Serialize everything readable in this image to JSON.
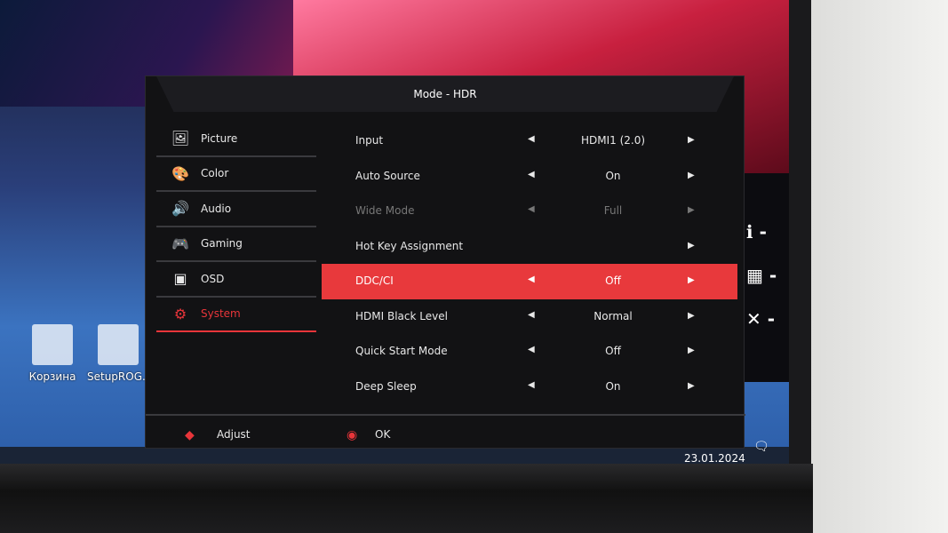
{
  "osd": {
    "title": "Mode - HDR",
    "menu": [
      {
        "label": "Picture",
        "icon": "picture-icon",
        "glyph": "🖼"
      },
      {
        "label": "Color",
        "icon": "palette-icon",
        "glyph": "🎨"
      },
      {
        "label": "Audio",
        "icon": "speaker-icon",
        "glyph": "🔊"
      },
      {
        "label": "Gaming",
        "icon": "gamepad-icon",
        "glyph": "🎮"
      },
      {
        "label": "OSD",
        "icon": "osd-window-icon",
        "glyph": "▣"
      },
      {
        "label": "System",
        "icon": "gear-icon",
        "glyph": "⚙",
        "active": true
      }
    ],
    "settings": [
      {
        "label": "Input",
        "value": "HDMI1 (2.0)"
      },
      {
        "label": "Auto Source",
        "value": "On"
      },
      {
        "label": "Wide Mode",
        "value": "Full",
        "disabled": true
      },
      {
        "label": "Hot Key Assignment",
        "value": ""
      },
      {
        "label": "DDC/CI",
        "value": "Off",
        "selected": true
      },
      {
        "label": "HDMI Black Level",
        "value": "Normal"
      },
      {
        "label": "Quick Start Mode",
        "value": "Off"
      },
      {
        "label": "Deep Sleep",
        "value": "On"
      }
    ],
    "footer": {
      "adjust": "Adjust",
      "ok": "OK"
    },
    "accent": "#e8393c"
  },
  "desktop": {
    "icons": [
      "Корзина",
      "SetupROG..."
    ],
    "date": "23.01.2024"
  },
  "side_keys": [
    {
      "icon": "info-icon",
      "glyph": "ℹ"
    },
    {
      "icon": "grid-icon",
      "glyph": "▦"
    },
    {
      "icon": "close-icon",
      "glyph": "✕"
    }
  ]
}
